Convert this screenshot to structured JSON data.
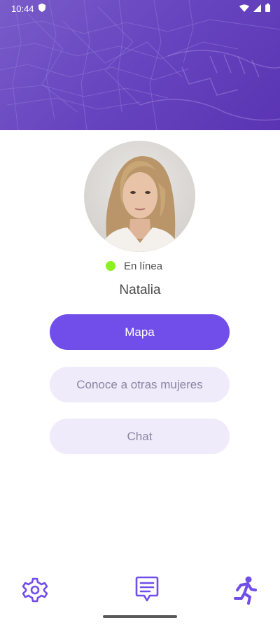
{
  "status_bar": {
    "time": "10:44",
    "left_icons": [
      "shield-icon"
    ],
    "right_icons": [
      "wifi-icon",
      "signal-icon",
      "battery-icon"
    ]
  },
  "header": {
    "background": "map-pattern",
    "colors": [
      "#7a5cc9",
      "#5a34b3"
    ]
  },
  "profile": {
    "avatar": "avatar-photo",
    "status_label": "En línea",
    "status_color": "#8cf21d",
    "name": "Natalia"
  },
  "actions": {
    "map_label": "Mapa",
    "meet_label": "Conoce a otras mujeres",
    "chat_label": "Chat"
  },
  "bottom_nav": {
    "items": [
      "settings-icon",
      "chat-icon",
      "running-person-icon"
    ],
    "accent": "#714de9"
  },
  "colors": {
    "primary": "#714de9",
    "secondary_bg": "#efebfb",
    "secondary_text": "#8b86a0"
  }
}
